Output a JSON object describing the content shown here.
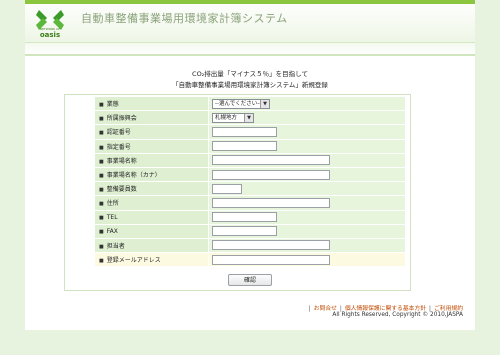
{
  "header": {
    "logo_text": "oasis",
    "logo_sub": "NETWORK OF",
    "app_title": "自動車整備事業場用環境家計簿システム"
  },
  "page": {
    "heading_line1": "CO₂排出量「マイナス５％」を目指して",
    "heading_line2": "「自動車整備事業場用環境家計簿システム」新規登録"
  },
  "form": {
    "rows": [
      {
        "label": "業態",
        "type": "select",
        "value": "--選んでください--",
        "width": 58
      },
      {
        "label": "所属振興会",
        "type": "select",
        "value": "札幌地方",
        "width": 42
      },
      {
        "label": "認証番号",
        "type": "input",
        "value": "",
        "width": 65
      },
      {
        "label": "指定番号",
        "type": "input",
        "value": "",
        "width": 65
      },
      {
        "label": "事業場名称",
        "type": "input",
        "value": "",
        "width": 118
      },
      {
        "label": "事業場名称（カナ）",
        "type": "input",
        "value": "",
        "width": 118
      },
      {
        "label": "整備要員数",
        "type": "input",
        "value": "",
        "width": 30
      },
      {
        "label": "住所",
        "type": "input",
        "value": "",
        "width": 118
      },
      {
        "label": "TEL",
        "type": "input",
        "value": "",
        "width": 65
      },
      {
        "label": "FAX",
        "type": "input",
        "value": "",
        "width": 65
      },
      {
        "label": "担当者",
        "type": "input",
        "value": "",
        "width": 118
      },
      {
        "label": "登録メールアドレス",
        "type": "input",
        "value": "",
        "width": 118
      }
    ],
    "submit_label": "確認"
  },
  "footer": {
    "links": [
      "お問合せ",
      "個人情報保護に関する基本方針",
      "ご利用規約"
    ],
    "copyright": "All Rights Reserved, Copyright © 2010,JASPA"
  },
  "colors": {
    "accent": "#8cc63f",
    "label_bg": "#dff0d2",
    "value_bg": "#e7f5dd",
    "highlight_row": "#fcfbe2",
    "link": "#c24a00"
  }
}
